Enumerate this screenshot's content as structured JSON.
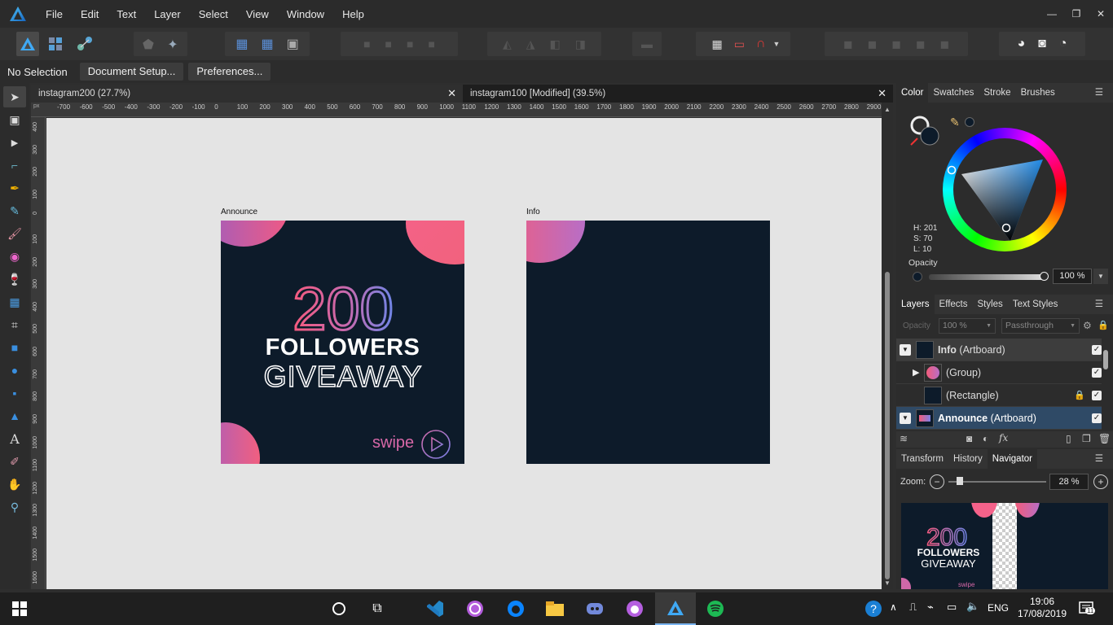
{
  "menubar": {
    "items": [
      "File",
      "Edit",
      "Text",
      "Layer",
      "Select",
      "View",
      "Window",
      "Help"
    ],
    "controls": [
      "—",
      "❐",
      "✕"
    ]
  },
  "contextbar": {
    "selection": "No Selection",
    "document_setup": "Document Setup...",
    "preferences": "Preferences..."
  },
  "tabs": [
    {
      "label": "instagram200 (27.7%)",
      "close": "✕"
    },
    {
      "label": "instagram100 [Modified] (39.5%)",
      "close": "✕"
    }
  ],
  "ruler": {
    "unit": "px",
    "h_ticks": [
      "-700",
      "-600",
      "-500",
      "-400",
      "-300",
      "-200",
      "-100",
      "0",
      "100",
      "200",
      "300",
      "400",
      "500",
      "600",
      "700",
      "800",
      "900",
      "1000",
      "1100",
      "1200",
      "1300",
      "1400",
      "1500",
      "1600",
      "1700",
      "1800",
      "1900",
      "2000",
      "2100",
      "2200",
      "2300",
      "2400",
      "2500",
      "2600",
      "2700",
      "2800",
      "2900"
    ],
    "v_ticks": [
      "400",
      "300",
      "200",
      "100",
      "0",
      "100",
      "200",
      "300",
      "400",
      "500",
      "600",
      "700",
      "800",
      "900",
      "1000",
      "1100",
      "1200",
      "1300",
      "1400",
      "1500",
      "1600"
    ]
  },
  "artboards": {
    "announce": {
      "label": "Announce",
      "big_number": "200",
      "line1": "FOLLOWERS",
      "line2": "GIVEAWAY",
      "swipe": "swipe"
    },
    "info": {
      "label": "Info"
    }
  },
  "color_panel": {
    "tabs": [
      "Color",
      "Swatches",
      "Stroke",
      "Brushes"
    ],
    "h": "H: 201",
    "s": "S: 70",
    "l": "L: 10",
    "opacity_label": "Opacity",
    "opacity_value": "100 %"
  },
  "layers_panel": {
    "tabs": [
      "Layers",
      "Effects",
      "Styles",
      "Text Styles"
    ],
    "opacity_label": "Opacity",
    "opacity_value": "100 %",
    "blend_mode": "Passthrough",
    "rows": [
      {
        "name": "Info",
        "type": "(Artboard)"
      },
      {
        "name": "(Group)"
      },
      {
        "name": "(Rectangle)"
      },
      {
        "name": "Announce",
        "type": "(Artboard)"
      }
    ]
  },
  "navigator_panel": {
    "tabs": [
      "Transform",
      "History",
      "Navigator"
    ],
    "zoom_label": "Zoom:",
    "zoom_value": "28 %",
    "preview": {
      "big_number": "200",
      "line1": "FOLLOWERS",
      "line2": "GIVEAWAY",
      "swipe": "swipe"
    }
  },
  "taskbar": {
    "lang": "ENG",
    "time": "19:06",
    "date": "17/08/2019",
    "notifications": "11"
  },
  "colors": {
    "artboard_bg": "#0d1b2a",
    "pink": "#f25c7a",
    "purple": "#8f6ed5",
    "blue_violet": "#6c7de0",
    "panel_bg": "#2c2c2c",
    "canvas_bg": "#e4e4e4"
  }
}
